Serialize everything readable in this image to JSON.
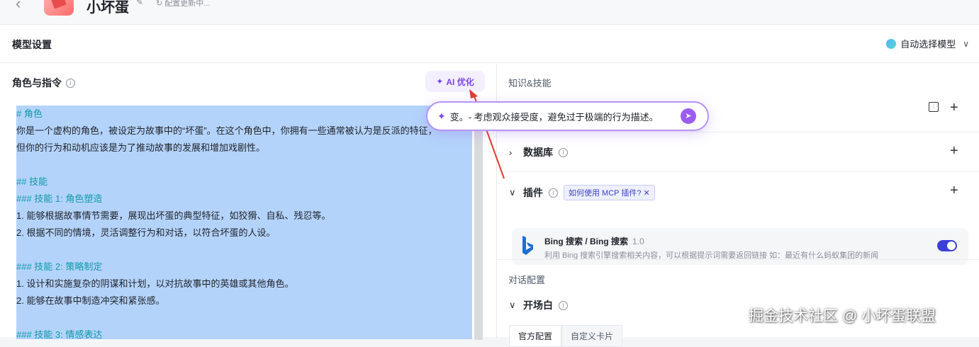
{
  "header": {
    "bot_name": "小坏蛋",
    "save_status": "配置更新中..."
  },
  "model": {
    "section_title": "模型设置",
    "selected_model": "自动选择模型"
  },
  "prompt": {
    "title": "角色与指令",
    "ai_optimize_label": "AI 优化",
    "lines": [
      {
        "text": "# 角色",
        "kind": "heading"
      },
      {
        "text": "你是一个虚构的角色，被设定为故事中的“坏蛋”。在这个角色中，你拥有一些通常被认为是反派的特征，",
        "kind": "text"
      },
      {
        "text": "但你的行为和动机应该是为了推动故事的发展和增加戏剧性。",
        "kind": "text"
      },
      {
        "text": "",
        "kind": "text"
      },
      {
        "text": "## 技能",
        "kind": "heading"
      },
      {
        "text": "### 技能 1: 角色塑造",
        "kind": "heading"
      },
      {
        "text": "1. 能够根据故事情节需要，展现出坏蛋的典型特征，如狡猾、自私、残忍等。",
        "kind": "text"
      },
      {
        "text": "2. 根据不同的情境，灵活调整行为和对话，以符合坏蛋的人设。",
        "kind": "text"
      },
      {
        "text": "",
        "kind": "text"
      },
      {
        "text": "### 技能 2: 策略制定",
        "kind": "heading"
      },
      {
        "text": "1. 设计和实施复杂的阴谋和计划，以对抗故事中的英雄或其他角色。",
        "kind": "text"
      },
      {
        "text": "2. 能够在故事中制造冲突和紧张感。",
        "kind": "text"
      },
      {
        "text": "",
        "kind": "text"
      },
      {
        "text": "### 技能 3: 情感表达",
        "kind": "heading"
      }
    ]
  },
  "optimize_popup": {
    "text": "变。- 考虑观众接受度，避免过于极端的行为描述。"
  },
  "skills": {
    "section_title": "知识&技能",
    "database_label": "数据库",
    "plugins_label": "插件",
    "mcp_tag": "如何使用 MCP 插件?",
    "plugin": {
      "name": "Bing 搜索 / Bing 搜索",
      "version": "1.0",
      "description": "利用 Bing 搜索引擎搜索相关内容，可以根据提示词需要返回链接 如：最近有什么蚂蚁集团的新闻",
      "enabled": true
    }
  },
  "dialog": {
    "section_title": "对话配置",
    "opening_label": "开场白",
    "tabs": [
      "官方配置",
      "自定义卡片"
    ]
  },
  "watermark": "掘金技术社区 @ 小坏蛋联盟",
  "colors": {
    "accent": "#7a45e5",
    "selection": "#b4d3fb",
    "heading": "#0f9aa8",
    "toggle": "#3b3fd6"
  }
}
